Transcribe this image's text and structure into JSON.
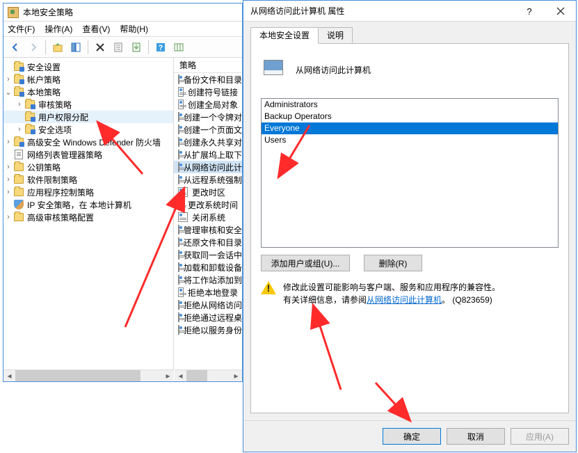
{
  "mmc": {
    "title": "本地安全策略",
    "menu": {
      "file": "文件(F)",
      "action": "操作(A)",
      "view": "查看(V)",
      "help": "帮助(H)"
    },
    "tree_header": "策略",
    "root": "安全设置",
    "nodes": {
      "account": "帐户策略",
      "local": "本地策略",
      "audit": "审核策略",
      "user_rights": "用户权限分配",
      "sec_options": "安全选项",
      "defender": "高级安全 Windows Defender 防火墙",
      "netlist": "网络列表管理器策略",
      "pubkey": "公钥策略",
      "software": "软件限制策略",
      "appctrl": "应用程序控制策略",
      "ipsec": "IP 安全策略，在 本地计算机",
      "advaudit": "高级审核策略配置"
    },
    "policies": [
      "备份文件和目录",
      "创建符号链接",
      "创建全局对象",
      "创建一个令牌对象",
      "创建一个页面文件",
      "创建永久共享对象",
      "从扩展坞上取下",
      "从网络访问此计算机",
      "从远程系统强制关机",
      "更改时区",
      "更改系统时间",
      "关闭系统",
      "管理审核和安全日志",
      "还原文件和目录",
      "获取同一会话中另一个用户的模拟令牌",
      "加载和卸载设备驱动程序",
      "将工作站添加到域",
      "拒绝本地登录",
      "拒绝从网络访问此计算机",
      "拒绝通过远程桌面服务登录",
      "拒绝以服务身份登录"
    ],
    "selected_policy_index": 7
  },
  "dialog": {
    "title": "从网络访问此计算机 属性",
    "tabs": {
      "local": "本地安全设置",
      "explain": "说明"
    },
    "policy_name": "从网络访问此计算机",
    "members": [
      "Administrators",
      "Backup Operators",
      "Everyone",
      "Users"
    ],
    "selected_member_index": 2,
    "buttons": {
      "add": "添加用户或组(U)...",
      "remove": "删除(R)",
      "ok": "确定",
      "cancel": "取消",
      "apply": "应用(A)"
    },
    "note_line1": "修改此设置可能影响与客户端、服务和应用程序的兼容性。",
    "note_line2a": "有关详细信息，请参阅",
    "note_link": "从网络访问此计算机",
    "note_line2b": "。 (Q823659)"
  }
}
